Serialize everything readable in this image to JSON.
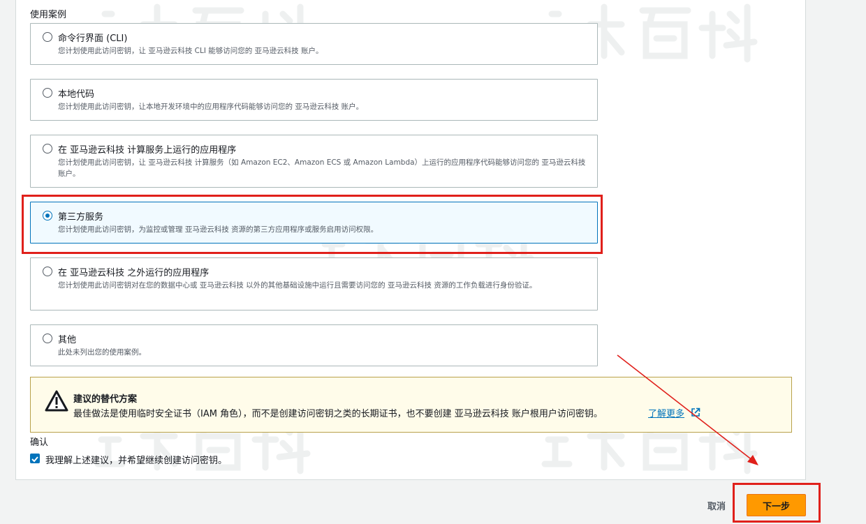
{
  "section_label": "使用案例",
  "options": [
    {
      "title": "命令行界面 (CLI)",
      "desc": "您计划使用此访问密钥，让 亚马逊云科技 CLI 能够访问您的 亚马逊云科技 账户。",
      "selected": false
    },
    {
      "title": "本地代码",
      "desc": "您计划使用此访问密钥，让本地开发环境中的应用程序代码能够访问您的 亚马逊云科技 账户。",
      "selected": false
    },
    {
      "title": "在 亚马逊云科技 计算服务上运行的应用程序",
      "desc": "您计划使用此访问密钥，让 亚马逊云科技 计算服务（如 Amazon EC2、Amazon ECS 或 Amazon Lambda）上运行的应用程序代码能够访问您的 亚马逊云科技 账户。",
      "selected": false
    },
    {
      "title": "第三方服务",
      "desc": "您计划使用此访问密钥，为监控或管理 亚马逊云科技 资源的第三方应用程序或服务启用访问权限。",
      "selected": true
    },
    {
      "title": "在 亚马逊云科技 之外运行的应用程序",
      "desc": "您计划使用此访问密钥对在您的数据中心或 亚马逊云科技 以外的其他基础设施中运行且需要访问您的 亚马逊云科技 资源的工作负载进行身份验证。",
      "selected": false
    },
    {
      "title": "其他",
      "desc": "此处未列出您的使用案例。",
      "selected": false
    }
  ],
  "alert": {
    "title": "建议的替代方案",
    "text": "最佳做法是使用临时安全证书（IAM 角色），而不是创建访问密钥之类的长期证书，也不要创建 亚马逊云科技 账户根用户访问密钥。",
    "link": "了解更多",
    "icon": "warning-icon"
  },
  "confirm": {
    "label": "确认",
    "checkbox_text": "我理解上述建议，并希望继续创建访问密钥。",
    "checked": true
  },
  "footer": {
    "cancel_label": "取消",
    "next_label": "下一步"
  },
  "watermark_text": "站长百科",
  "colors": {
    "accent": "#0073bb",
    "primary_button": "#ff9900",
    "annotation_red": "#e0201b",
    "alert_bg": "#fffcea"
  }
}
